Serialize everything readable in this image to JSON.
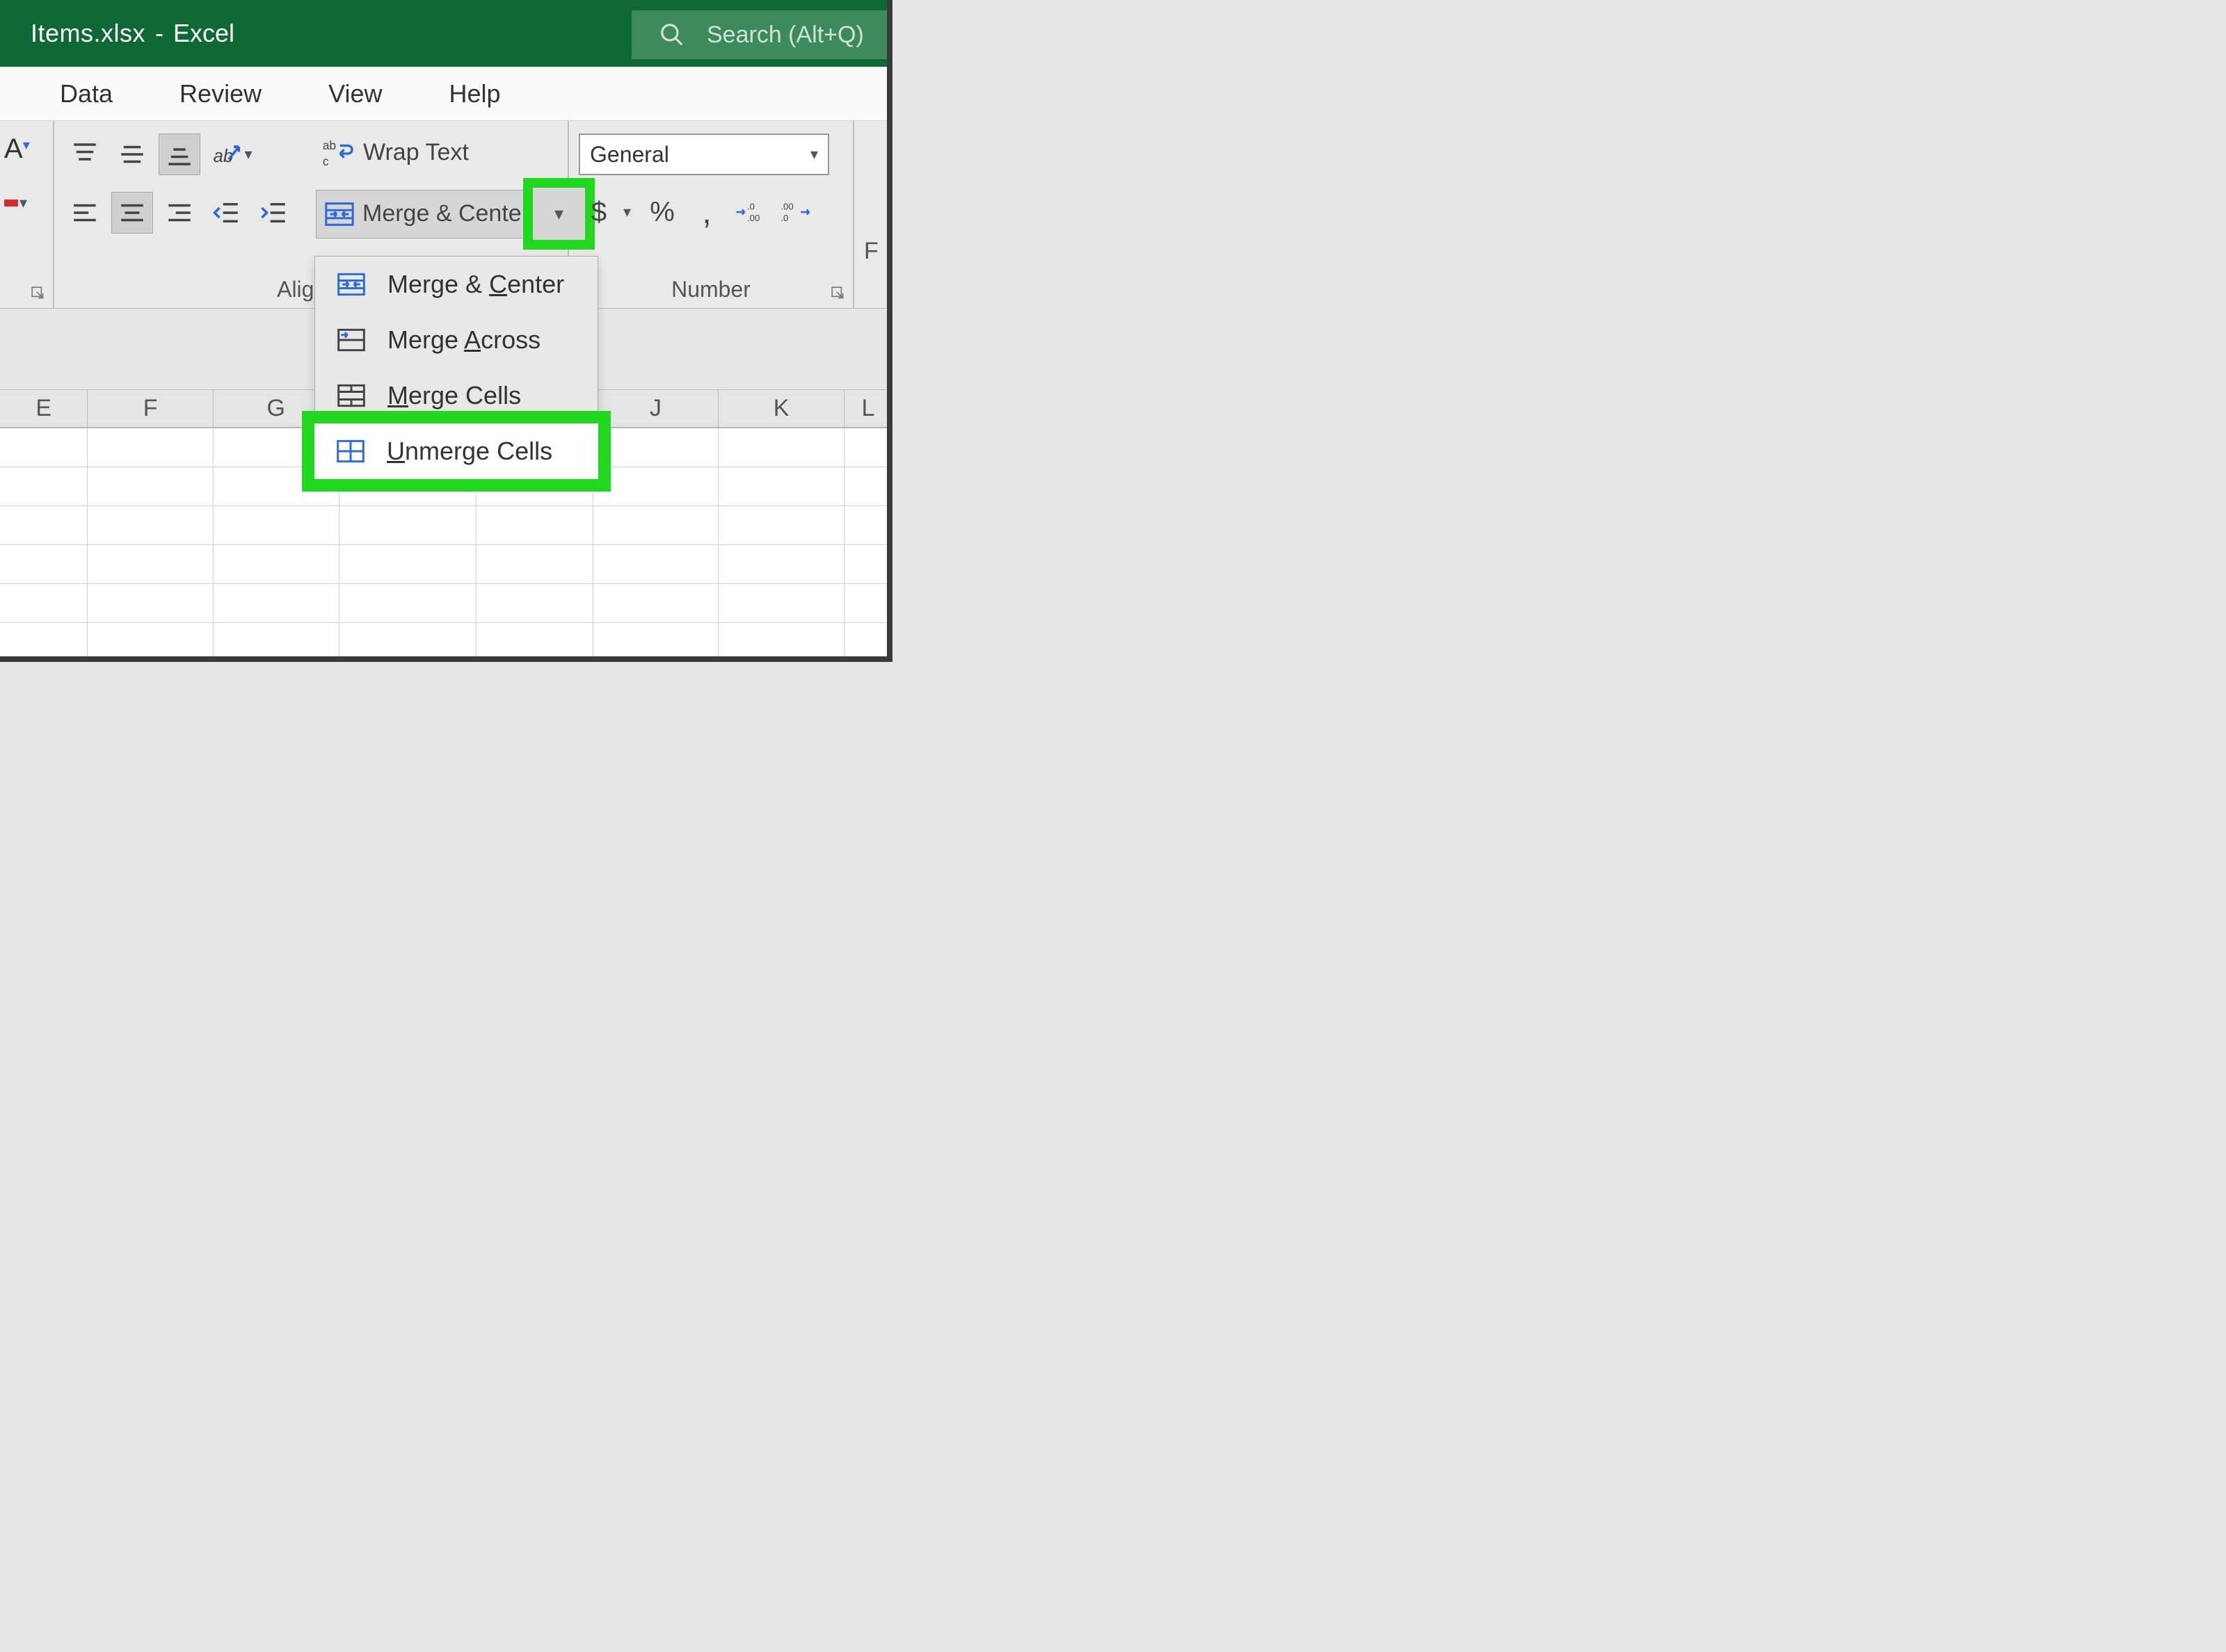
{
  "title": {
    "filename": "Items.xlsx",
    "divider": "-",
    "app": "Excel"
  },
  "search": {
    "placeholder": "Search (Alt+Q)"
  },
  "tabs": {
    "data": "Data",
    "review": "Review",
    "view": "View",
    "help": "Help"
  },
  "ribbon": {
    "alignment_label": "Alignm",
    "wrap_text": "Wrap Text",
    "merge_center": "Merge & Center",
    "number_label": "Number",
    "number_format": "General",
    "font_partial": "F"
  },
  "merge_menu": {
    "merge_center": "Merge & Center",
    "merge_across": "Merge Across",
    "merge_cells": "Merge Cells",
    "unmerge_cells": "Unmerge Cells"
  },
  "columns": {
    "e": "E",
    "f": "F",
    "g": "G",
    "j": "J",
    "k": "K",
    "l": "L"
  },
  "icons": {
    "arrow_down": "▾"
  }
}
